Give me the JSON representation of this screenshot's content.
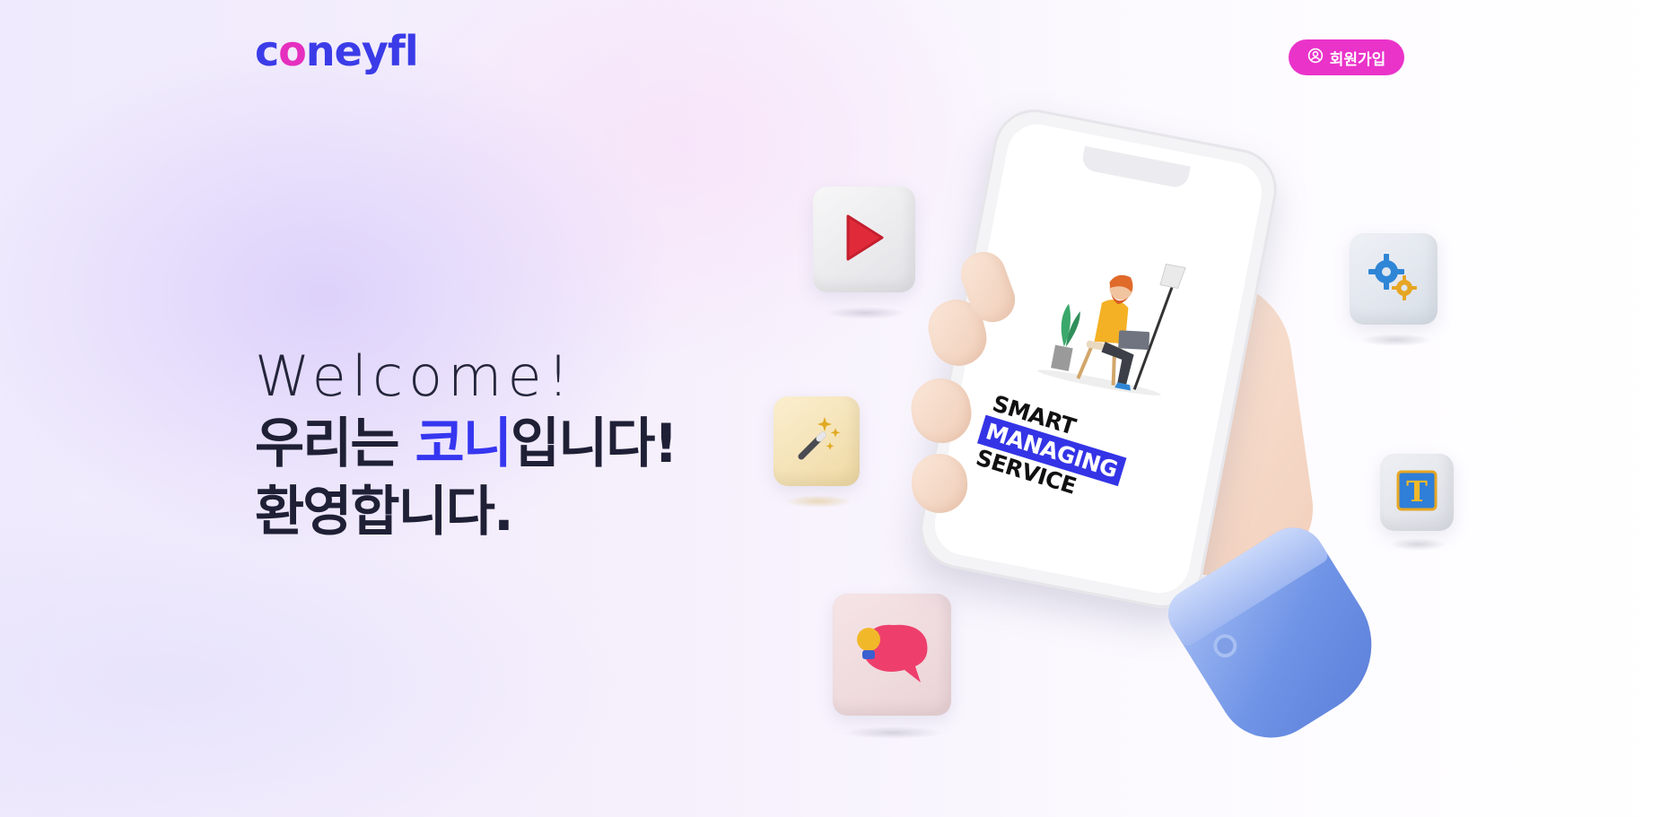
{
  "header": {
    "logo_text_pre": "c",
    "logo_text_o": "o",
    "logo_text_post": "neyfl",
    "signup_label": "회원가입"
  },
  "hero": {
    "welcome": "Welcome!",
    "line1_pre": "우리는 ",
    "line1_accent": "코니",
    "line1_post": "입니다!",
    "line2": "환영합니다."
  },
  "phone_screen": {
    "line1": "SMART",
    "line2": "MANAGING",
    "line3": "SERVICE"
  },
  "colors": {
    "brand_blue": "#3b3ce8",
    "brand_pink": "#ea33c9",
    "accent_blue": "#3636f0",
    "text_dark": "#1f2036"
  },
  "icons": [
    "user-circle-icon",
    "play-icon",
    "magic-wand-icon",
    "gears-icon",
    "text-format-icon",
    "speech-bubble-lightbulb-icon"
  ]
}
